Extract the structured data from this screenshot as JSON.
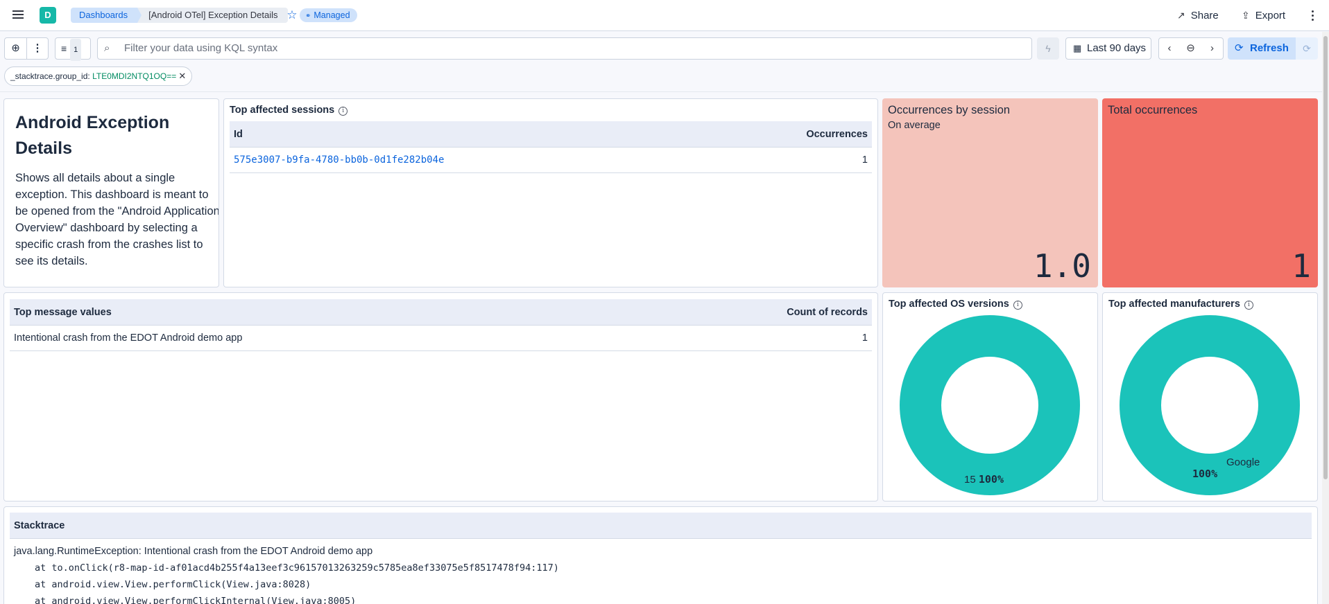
{
  "header": {
    "app_initial": "D",
    "breadcrumbs": [
      "Dashboards",
      "[Android OTel] Exception Details"
    ],
    "managed_badge": "Managed",
    "share_label": "Share",
    "export_label": "Export"
  },
  "query_bar": {
    "filter_count": "1",
    "search_placeholder": "Filter your data using KQL syntax",
    "time_range": "Last 90 days",
    "refresh_label": "Refresh"
  },
  "filter_pill": {
    "field": "_stacktrace.group_id:",
    "value": "LTE0MDI2NTQ1OQ=="
  },
  "markdown": {
    "title": "Android Exception Details",
    "body": "Shows all details about a single exception. This dashboard is meant to be opened from the \"Android Application Overview\" dashboard by selecting a specific crash from the crashes list to see its details."
  },
  "sessions_panel": {
    "title": "Top affected sessions",
    "columns": [
      "Id",
      "Occurrences"
    ],
    "rows": [
      {
        "id": "575e3007-b9fa-4780-bb0b-0d1fe282b04e",
        "occurrences": "1"
      }
    ]
  },
  "occ_by_session": {
    "title": "Occurrences by session",
    "subtitle": "On average",
    "value": "1.0",
    "color": "#f4c4bb"
  },
  "total_occ": {
    "title": "Total occurrences",
    "value": "1",
    "color": "#f27066"
  },
  "messages_panel": {
    "title_column": "Top message values",
    "count_column": "Count of records",
    "rows": [
      {
        "message": "Intentional crash from the EDOT Android demo app",
        "count": "1"
      }
    ]
  },
  "os_panel": {
    "title": "Top affected OS versions",
    "slice_label": "15",
    "slice_percent": "100%",
    "color": "#1bc3ba"
  },
  "manufacturers_panel": {
    "title": "Top affected manufacturers",
    "slice_label": "Google",
    "slice_percent": "100%",
    "color": "#1bc3ba"
  },
  "stacktrace_panel": {
    "title": "Stacktrace",
    "lines": [
      "java.lang.RuntimeException: Intentional crash from the EDOT Android demo app",
      "at to.onClick(r8-map-id-af01acd4b255f4a13eef3c96157013263259c5785ea8ef33075e5f8517478f94:117)",
      "at android.view.View.performClick(View.java:8028)",
      "at android.view.View.performClickInternal(View.java:8005)"
    ]
  }
}
